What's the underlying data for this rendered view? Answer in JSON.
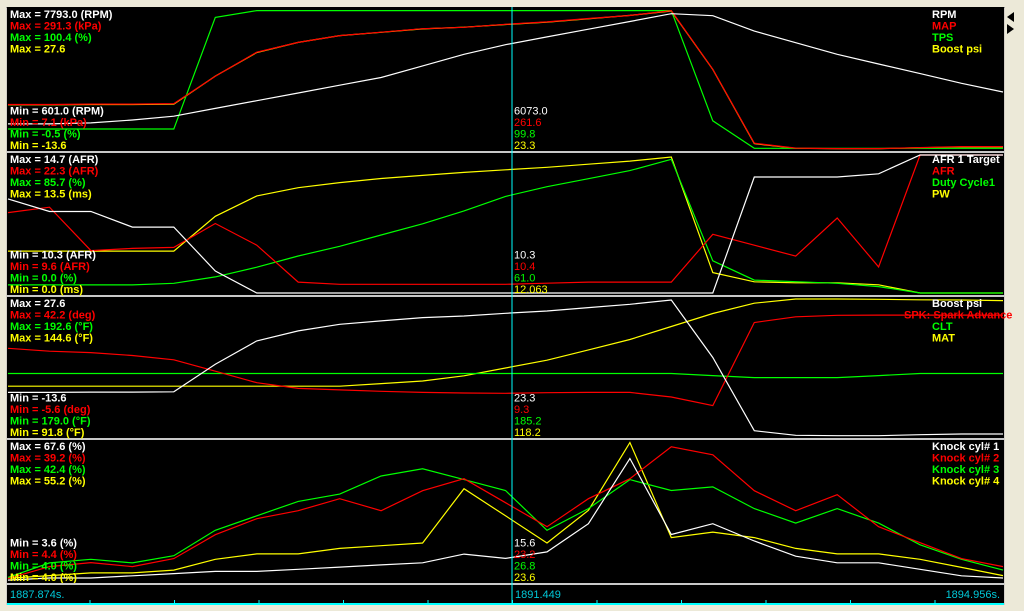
{
  "colors": {
    "c0": "#ffffff",
    "c1": "#ff0000",
    "c2": "#00ff00",
    "c3": "#ffff00",
    "cursor": "#00ffff",
    "separator": "#c8c8c8"
  },
  "time_axis": {
    "start_label": "1887.874s.",
    "cursor_label": "1891.449",
    "end_label": "1894.956s.",
    "start": 1887.874,
    "end": 1894.956,
    "cursor": 1891.449
  },
  "chart_data": {
    "type": "line",
    "samples": 25,
    "panels": [
      {
        "traces": [
          {
            "name": "RPM",
            "max_label": "Max = 7793.0 (RPM)",
            "min_label": "Min = 601.0 (RPM)",
            "cursor_value": "6073.0",
            "min": 601.0,
            "max": 7793.0,
            "values": [
              1900,
              1900,
              1950,
              2100,
              2300,
              2700,
              3100,
              3500,
              3900,
              4300,
              4900,
              5500,
              6000,
              6400,
              6800,
              7200,
              7600,
              7500,
              6700,
              6100,
              5500,
              5000,
              4500,
              4000,
              3550
            ]
          },
          {
            "name": "MAP",
            "max_label": "Max = 291.3 (kPa)",
            "min_label": "Min = 7.1 (kPa)",
            "cursor_value": "261.6",
            "min": 7.1,
            "max": 291.3,
            "values": [
              98,
              98,
              99,
              99,
              100,
              156,
              205,
              225,
              239,
              246,
              253,
              256,
              262,
              267,
              274,
              280,
              290,
              170,
              19,
              9,
              8,
              8,
              10,
              12,
              12
            ]
          },
          {
            "name": "TPS",
            "max_label": "Max = 100.4 (%)",
            "min_label": "Min = -0.5 (%)",
            "cursor_value": "99.8",
            "min": -0.5,
            "max": 100.4,
            "values": [
              14,
              14,
              14,
              14,
              14,
              95,
              100,
              100,
              100,
              100,
              100,
              100,
              100,
              100,
              100,
              100,
              100,
              20,
              0,
              0,
              0,
              0,
              0,
              0,
              0
            ]
          },
          {
            "name": "Boost psi",
            "max_label": "Max = 27.6",
            "min_label": "Min = -13.6",
            "cursor_value": "23.3",
            "min": -13.6,
            "max": 27.6,
            "values": [
              -0.5,
              -0.5,
              -0.4,
              -0.4,
              -0.3,
              8,
              15,
              18,
              20,
              21,
              22,
              22.5,
              23.3,
              24,
              25,
              26,
              27.3,
              10,
              -12,
              -13.4,
              -13.5,
              -13.5,
              -13.2,
              -13,
              -13
            ]
          }
        ]
      },
      {
        "traces": [
          {
            "name": "AFR 1 Target",
            "max_label": "Max = 14.7 (AFR)",
            "min_label": "Min = 10.3 (AFR)",
            "cursor_value": "10.3",
            "min": 10.3,
            "max": 14.7,
            "values": [
              13.3,
              12.9,
              12.9,
              12.4,
              12.4,
              11.0,
              10.3,
              10.3,
              10.3,
              10.3,
              10.3,
              10.3,
              10.3,
              10.3,
              10.3,
              10.3,
              10.3,
              10.3,
              14.0,
              14.0,
              14.0,
              14.1,
              14.7,
              14.7,
              14.7
            ]
          },
          {
            "name": "AFR",
            "max_label": "Max = 22.3 (AFR)",
            "min_label": "Min = 9.6 (AFR)",
            "cursor_value": "10.4",
            "min": 9.6,
            "max": 22.3,
            "values": [
              17.0,
              17.5,
              13.5,
              13.7,
              13.8,
              16.0,
              14.0,
              10.6,
              10.4,
              10.4,
              10.4,
              10.4,
              10.4,
              10.5,
              10.6,
              10.6,
              10.6,
              15.0,
              14.0,
              13.0,
              16.5,
              12.0,
              22.3,
              22.3,
              22.3
            ]
          },
          {
            "name": "Duty Cycle1",
            "max_label": "Max = 85.7 (%)",
            "min_label": "Min = 0.0 (%)",
            "cursor_value": "61.0",
            "min": 0.0,
            "max": 85.7,
            "values": [
              5,
              5,
              5,
              5,
              6,
              10,
              16,
              23,
              29,
              36,
              43,
              51,
              60,
              66,
              71,
              76,
              83,
              20,
              8,
              7,
              6,
              4,
              0,
              0,
              0
            ]
          },
          {
            "name": "PW",
            "max_label": "Max = 13.5 (ms)",
            "min_label": "Min = 0.0 (ms)",
            "cursor_value": "12.063",
            "min": 0.0,
            "max": 13.5,
            "values": [
              4.1,
              4.1,
              4.1,
              4.1,
              4.1,
              7.5,
              9.5,
              10.3,
              10.8,
              11.2,
              11.5,
              11.8,
              12.05,
              12.3,
              12.6,
              12.9,
              13.3,
              2,
              1.1,
              1,
              1,
              0.8,
              0,
              0,
              0
            ]
          }
        ]
      },
      {
        "traces": [
          {
            "name": "Boost psi",
            "max_label": "Max = 27.6",
            "min_label": "Min = -13.6",
            "cursor_value": "23.3",
            "min": -13.6,
            "max": 27.6,
            "values": [
              -0.5,
              -0.5,
              -0.4,
              -0.4,
              -0.3,
              8,
              15,
              18,
              20,
              21,
              22,
              22.5,
              23.3,
              24,
              25,
              26,
              27.3,
              10,
              -12,
              -13.4,
              -13.5,
              -13.5,
              -13.2,
              -13,
              -13
            ]
          },
          {
            "name": "SPK: Spark Advance",
            "max_label": "Max = 42.2 (deg)",
            "min_label": "Min = -5.6 (deg)",
            "cursor_value": "9.3",
            "min": -5.6,
            "max": 42.2,
            "values": [
              25,
              24,
              23.5,
              22.5,
              21,
              17,
              13,
              11,
              10.5,
              10,
              9.6,
              9.4,
              9.3,
              9.5,
              9.6,
              9.6,
              8,
              5,
              34,
              36,
              36.5,
              36.6,
              36.6,
              36.6,
              36.6
            ]
          },
          {
            "name": "CLT",
            "max_label": "Max = 192.6 (°F)",
            "min_label": "Min = 179.0 (°F)",
            "cursor_value": "185.2",
            "min": 179.0,
            "max": 192.6,
            "values": [
              185.2,
              185.2,
              185.2,
              185.2,
              185.2,
              185.2,
              185.2,
              185.2,
              185.2,
              185.2,
              185.2,
              185.2,
              185.2,
              185.2,
              185.2,
              185.2,
              185.2,
              185.0,
              184.8,
              184.8,
              184.8,
              185.0,
              185.2,
              185.2,
              185.2
            ]
          },
          {
            "name": "MAT",
            "max_label": "Max = 144.6 (°F)",
            "min_label": "Min = 91.8 (°F)",
            "cursor_value": "118.2",
            "min": 91.8,
            "max": 144.6,
            "values": [
              111,
              111,
              111,
              111,
              111,
              111,
              111,
              111,
              111,
              112,
              113,
              115,
              118,
              121,
              125,
              129,
              134,
              139,
              143,
              144.6,
              144.6,
              144.5,
              144.3,
              144.2,
              144
            ]
          }
        ]
      },
      {
        "traces": [
          {
            "name": "Knock cyl# 1",
            "max_label": "Max = 67.6 (%)",
            "min_label": "Min = 3.6 (%)",
            "cursor_value": "15.6",
            "min": 3.6,
            "max": 67.6,
            "values": [
              4,
              5,
              5,
              6,
              7,
              8,
              8,
              9,
              10,
              11,
              12,
              16,
              14,
              17,
              30,
              60,
              25,
              30,
              22,
              15,
              12,
              12,
              9,
              6,
              5
            ]
          },
          {
            "name": "Knock cyl# 2",
            "max_label": "Max = 39.2 (%)",
            "min_label": "Min = 4.4 (%)",
            "cursor_value": "23.2",
            "min": 4.4,
            "max": 39.2,
            "values": [
              5,
              8,
              9,
              8,
              10,
              16,
              20,
              22,
              25,
              22,
              27,
              30,
              24,
              18,
              25,
              30,
              38,
              36,
              27,
              22,
              26,
              18,
              14,
              10,
              8
            ]
          },
          {
            "name": "Knock cyl# 3",
            "max_label": "Max = 42.4 (%)",
            "min_label": "Min = 4.0 (%)",
            "cursor_value": "26.8",
            "min": 4.0,
            "max": 42.4,
            "values": [
              5,
              9,
              10,
              9,
              11,
              18,
              22,
              26,
              28,
              33,
              35,
              32,
              29,
              18,
              24,
              32,
              29,
              30,
              24,
              20,
              24,
              20,
              14,
              10,
              7
            ]
          },
          {
            "name": "Knock cyl# 4",
            "max_label": "Max = 55.2 (%)",
            "min_label": "Min = 4.0 (%)",
            "cursor_value": "23.6",
            "min": 4.0,
            "max": 55.2,
            "values": [
              5,
              6,
              7,
              7,
              8,
              12,
              14,
              14,
              16,
              17,
              18,
              38,
              28,
              18,
              30,
              55,
              20,
              22,
              20,
              16,
              14,
              14,
              12,
              9,
              6
            ]
          }
        ]
      }
    ]
  }
}
